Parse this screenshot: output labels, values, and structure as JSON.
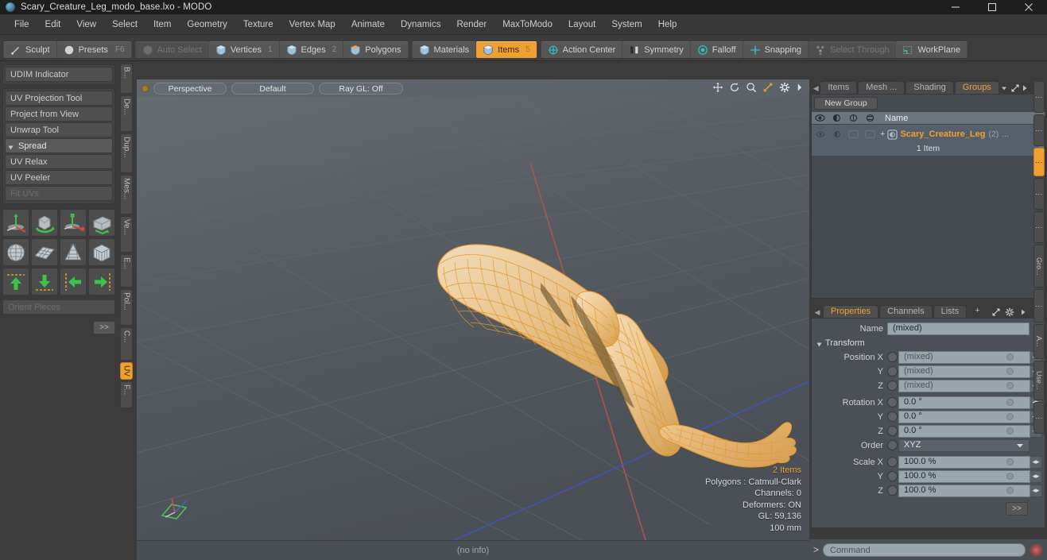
{
  "titlebar": {
    "title": "Scary_Creature_Leg_modo_base.lxo - MODO",
    "app_icon": "modo-sphere-icon",
    "minimize": "–",
    "maximize": "☐",
    "close": "✕"
  },
  "menubar": {
    "items": [
      {
        "label": "File"
      },
      {
        "label": "Edit"
      },
      {
        "label": "View"
      },
      {
        "label": "Select"
      },
      {
        "label": "Item"
      },
      {
        "label": "Geometry"
      },
      {
        "label": "Texture"
      },
      {
        "label": "Vertex Map"
      },
      {
        "label": "Animate"
      },
      {
        "label": "Dynamics"
      },
      {
        "label": "Render"
      },
      {
        "label": "MaxToModo"
      },
      {
        "label": "Layout"
      },
      {
        "label": "System"
      },
      {
        "label": "Help"
      }
    ]
  },
  "toolbar": {
    "groups": [
      {
        "buttons": [
          {
            "label": "Sculpt",
            "icon": "brush-icon",
            "state": "normal",
            "num": "",
            "key": ""
          },
          {
            "label": "Presets",
            "icon": "sphere-icon",
            "state": "normal",
            "num": "",
            "key": "F6"
          }
        ]
      },
      {
        "buttons": [
          {
            "label": "Auto Select",
            "icon": "shield-gray-icon",
            "state": "disabled",
            "num": "",
            "key": ""
          },
          {
            "label": "Vertices",
            "icon": "shield-blue-icon",
            "state": "normal",
            "num": "1",
            "key": ""
          },
          {
            "label": "Edges",
            "icon": "shield-blue-icon",
            "state": "normal",
            "num": "2",
            "key": ""
          },
          {
            "label": "Polygons",
            "icon": "shield-orange-icon",
            "state": "normal",
            "num": "",
            "key": ""
          }
        ]
      },
      {
        "buttons": [
          {
            "label": "Materials",
            "icon": "shield-blue-icon",
            "state": "normal",
            "num": "",
            "key": ""
          },
          {
            "label": "Items",
            "icon": "shield-blue-icon",
            "state": "active",
            "num": "5",
            "key": ""
          }
        ]
      },
      {
        "buttons": [
          {
            "label": "Action Center",
            "icon": "crosshair-circle-icon",
            "state": "normal",
            "num": "",
            "key": ""
          },
          {
            "label": "Symmetry",
            "icon": "symmetry-bars-icon",
            "state": "normal",
            "num": "",
            "key": ""
          },
          {
            "label": "Falloff",
            "icon": "falloff-circle-icon",
            "state": "normal",
            "num": "",
            "key": ""
          },
          {
            "label": "Snapping",
            "icon": "snap-cross-icon",
            "state": "normal",
            "num": "",
            "key": ""
          },
          {
            "label": "Select Through",
            "icon": "select-through-icon",
            "state": "disabled",
            "num": "",
            "key": ""
          },
          {
            "label": "WorkPlane",
            "icon": "workplane-icon",
            "state": "normal",
            "num": "",
            "key": ""
          }
        ]
      }
    ]
  },
  "left_panel": {
    "buttons_top": [
      {
        "label": "UDIM Indicator",
        "state": "normal"
      }
    ],
    "buttons_group1": [
      {
        "label": "UV Projection Tool",
        "state": "normal"
      },
      {
        "label": "Project from View",
        "state": "normal"
      },
      {
        "label": "Unwrap Tool",
        "state": "normal"
      }
    ],
    "spread_header": "Spread",
    "buttons_group2": [
      {
        "label": "UV Relax",
        "state": "normal"
      },
      {
        "label": "UV Peeler",
        "state": "normal"
      },
      {
        "label": "Fit UVs",
        "state": "disabled"
      }
    ],
    "icon_rows": [
      [
        "uv-move-gizmo-icon",
        "uv-rotate-cube-icon",
        "uv-scale-gizmo-icon",
        "uv-flip-box-icon"
      ],
      [
        "uv-sphere-grid-icon",
        "uv-plane-grid-icon",
        "uv-cone-grid-icon",
        "uv-box-grid-icon"
      ],
      [
        "uv-align-up-icon",
        "uv-align-down-icon",
        "uv-align-left-icon",
        "uv-align-right-icon"
      ]
    ],
    "orient_pieces": {
      "label": "Orient Pieces",
      "state": "disabled"
    },
    "more_button": ">>",
    "vtabs": [
      {
        "label": "B...",
        "active": false
      },
      {
        "label": "De...",
        "active": false
      },
      {
        "label": "Dup...",
        "active": false
      },
      {
        "label": "Mes...",
        "active": false
      },
      {
        "label": "Ve...",
        "active": false
      },
      {
        "label": "E...",
        "active": false
      },
      {
        "label": "Pol...",
        "active": false
      },
      {
        "label": "C...",
        "active": false
      },
      {
        "label": "UV",
        "active": true
      },
      {
        "label": "F...",
        "active": false
      }
    ]
  },
  "viewport": {
    "pills": [
      "Perspective",
      "Default",
      "Ray GL: Off"
    ],
    "tool_icons": [
      "pan-icon",
      "rotate-icon",
      "zoom-icon",
      "fit-icon",
      "gear-icon",
      "chevron-right-icon"
    ],
    "status": {
      "items": "2 Items",
      "polygons": "Polygons : Catmull-Clark",
      "channels": "Channels: 0",
      "deformers": "Deformers: ON",
      "gl": "GL: 59,136",
      "scale": "100 mm"
    },
    "axis_widget": "axis-gizmo-icon",
    "model": "scary-creature-leg-wireframe",
    "colors": {
      "background": "#555b60",
      "mesh_wire": "#e59a2e",
      "mesh_fill": "#f0cb92",
      "axis_x": "#b5554e",
      "axis_z": "#4a5fc0"
    }
  },
  "status_bar": {
    "text": "(no info)"
  },
  "right_panel": {
    "top_tabs": [
      {
        "label": "Items",
        "active": false
      },
      {
        "label": "Mesh ...",
        "active": false
      },
      {
        "label": "Shading",
        "active": false
      },
      {
        "label": "Groups",
        "active": true
      }
    ],
    "top_tab_icons": [
      "chevron-down-icon",
      "expand-icon",
      "chevron-right-icon"
    ],
    "new_group_button": "New Group",
    "group_list": {
      "column_icons": [
        "eye-icon",
        "shading-icon",
        "wire-icon",
        "render-icon"
      ],
      "name_header": "Name",
      "rows": [
        {
          "name": "Scary_Creature_Leg",
          "count": "(2)",
          "ellipsis": "...",
          "sub": "1 Item",
          "expand": "+",
          "icon": "group-icon"
        }
      ]
    },
    "properties": {
      "tabs": [
        {
          "label": "Properties",
          "active": true
        },
        {
          "label": "Channels",
          "active": false
        },
        {
          "label": "Lists",
          "active": false
        },
        {
          "label": "+",
          "active": false
        }
      ],
      "tab_icons": [
        "expand-icon",
        "gear-icon",
        "chevron-right-icon"
      ],
      "name": {
        "label": "Name",
        "value": "(mixed)"
      },
      "transform_header": "Transform",
      "fields": [
        {
          "label": "Position X",
          "value": "(mixed)",
          "type": "mixed"
        },
        {
          "label": "Y",
          "value": "(mixed)",
          "type": "mixed"
        },
        {
          "label": "Z",
          "value": "(mixed)",
          "type": "mixed"
        },
        {
          "label": "Rotation X",
          "value": "0.0 °",
          "type": "value"
        },
        {
          "label": "Y",
          "value": "0.0 °",
          "type": "value"
        },
        {
          "label": "Z",
          "value": "0.0 °",
          "type": "value"
        },
        {
          "label": "Order",
          "value": "XYZ",
          "type": "select"
        },
        {
          "label": "Scale X",
          "value": "100.0 %",
          "type": "value"
        },
        {
          "label": "Y",
          "value": "100.0 %",
          "type": "value"
        },
        {
          "label": "Z",
          "value": "100.0 %",
          "type": "value"
        }
      ],
      "more_button": ">>"
    },
    "vtabs": [
      {
        "label": "⋮",
        "active": false
      },
      {
        "label": "⋮",
        "active": false
      },
      {
        "label": "⋮",
        "active": true
      },
      {
        "label": "⋮",
        "active": false
      },
      {
        "label": "⋮",
        "active": false
      },
      {
        "label": "Gro...",
        "active": false
      },
      {
        "label": "⋮",
        "active": false
      },
      {
        "label": "A...",
        "active": false
      },
      {
        "label": "Use...",
        "active": false
      },
      {
        "label": "⋮",
        "active": false
      }
    ]
  },
  "command_bar": {
    "prompt": ">",
    "placeholder": "Command",
    "record_icon": "record-icon"
  }
}
